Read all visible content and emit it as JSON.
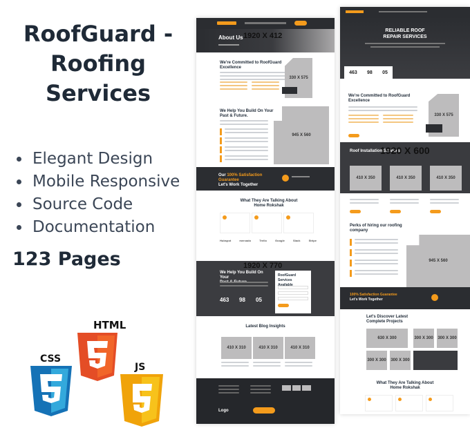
{
  "product": {
    "title_line1": "RoofGuard -",
    "title_line2": "Roofing",
    "title_line3": "Services",
    "features": [
      "Elegant Design",
      "Mobile Responsive",
      "Source Code",
      "Documentation"
    ],
    "pages_count": "123 Pages"
  },
  "tech_badges": {
    "css": "CSS",
    "html": "HTML",
    "js": "JS"
  },
  "colors": {
    "accent": "#f49b1c",
    "dark": "#2b2d31",
    "placeholder": "#bdbcbd"
  },
  "shot1": {
    "hero_title": "About Us",
    "hero_size": "1920 X 412",
    "committed_title_1": "We're Committed to RoofGuard",
    "committed_title_2": "Excellence",
    "img_330": "330 X 575",
    "build_title_1": "We Help You Build On Your",
    "build_title_2": "Past & Future.",
    "img_945": "945 X 560",
    "cta_text_1": "Our",
    "cta_highlight": "100% Satisfaction Guarantee",
    "cta_text_2": "Let's Work Together",
    "testimonials_title_1": "What They Are Talking About",
    "testimonials_title_2": "Home Rokshak",
    "brands": [
      "Hubspot",
      "mercado",
      "Trello",
      "Google",
      "Slack",
      "Stripe"
    ],
    "stats_size": "1920 X 770",
    "stats_title_1": "We Help You Build On Your",
    "stats_title_2": "Past & Future.",
    "stats": [
      "463",
      "98",
      "05"
    ],
    "form_title_1": "RoofGuard Services",
    "form_title_2": "Available",
    "blog_title": "Latest Blog Insights",
    "blog_imgs": [
      "410 X 310",
      "410 X 310",
      "410 X 310"
    ],
    "footer_logo": "Logo"
  },
  "shot2": {
    "hero_title_1": "RELIABLE ROOF",
    "hero_title_2": "REPAIR SERVICES",
    "stats": [
      "463",
      "98",
      "05"
    ],
    "committed_title_1": "We're Committed to RoofGuard",
    "committed_title_2": "Excellence",
    "img_330": "330 X 575",
    "services_title": "Roof Installation Services",
    "services_size": "1920 X 600",
    "service_imgs": [
      "410 X 350",
      "410 X 350",
      "410 X 350"
    ],
    "perks_title_1": "Perks of hiring our roofing",
    "perks_title_2": "company",
    "img_945": "945 X 560",
    "cta_highlight": "100% Satisfaction Guarantee",
    "cta_text_2": "Let's Work Together",
    "projects_title_1": "Let's Discover Latest",
    "projects_title_2": "Complete Projects",
    "proj_630": "630 X 300",
    "proj_300": [
      "300 X 300",
      "300 X 300",
      "300 X 300",
      "300 X 300"
    ],
    "testimonials_title_1": "What They Are Talking About",
    "testimonials_title_2": "Home Rokshak"
  }
}
